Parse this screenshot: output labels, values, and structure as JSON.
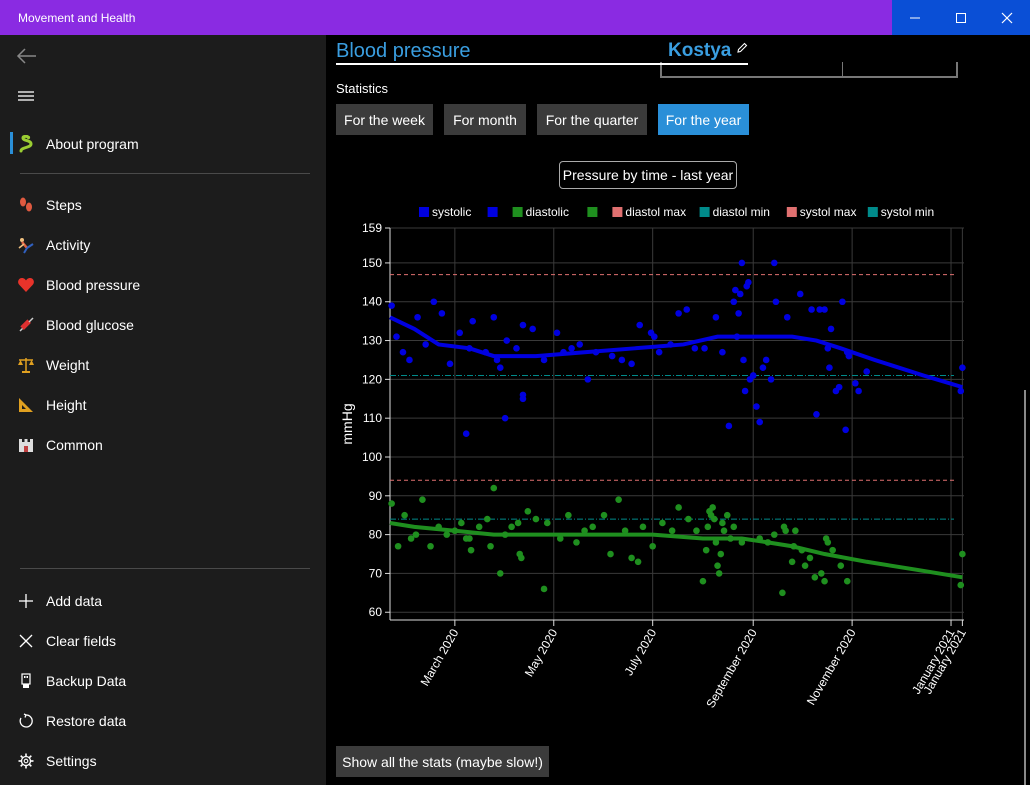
{
  "window": {
    "title": "Movement and Health"
  },
  "sidebar": {
    "top_item": {
      "label": "About program",
      "icon": "snake-icon"
    },
    "items": [
      {
        "label": "Steps",
        "icon": "footprints-icon"
      },
      {
        "label": "Activity",
        "icon": "gymnast-icon"
      },
      {
        "label": "Blood pressure",
        "icon": "heart-icon"
      },
      {
        "label": "Blood glucose",
        "icon": "syringe-icon"
      },
      {
        "label": "Weight",
        "icon": "scales-icon"
      },
      {
        "label": "Height",
        "icon": "triangle-ruler-icon"
      },
      {
        "label": "Common",
        "icon": "castle-icon"
      }
    ],
    "bottom_items": [
      {
        "label": "Add data",
        "icon": "plus-icon"
      },
      {
        "label": "Clear fields",
        "icon": "close-icon"
      },
      {
        "label": "Backup Data",
        "icon": "usb-drive-icon"
      },
      {
        "label": "Restore data",
        "icon": "refresh-icon"
      },
      {
        "label": "Settings",
        "icon": "gear-icon"
      }
    ]
  },
  "main": {
    "title": "Blood pressure",
    "user": "Kostya",
    "statistics_label": "Statistics",
    "tabs": [
      "For the week",
      "For month",
      "For the quarter",
      "For the year"
    ],
    "active_tab": "For the year",
    "chart_caption": "Pressure by time - last year",
    "show_all_label": "Show all the stats (maybe slow!)"
  },
  "colors": {
    "systolic": "#0000e0",
    "diastolic": "#1f8f1f",
    "diastol_max": "#e07070",
    "diastol_min": "#008b8b",
    "systol_max": "#e07070",
    "systol_min": "#008b8b",
    "accent": "#2a8fd8",
    "titlebar": "#8a2be2"
  },
  "chart_data": {
    "type": "scatter",
    "ylabel": "mmHg",
    "ylim": [
      58,
      159
    ],
    "y_ticks": [
      159,
      150,
      140,
      130,
      120,
      110,
      100,
      90,
      80,
      70,
      60
    ],
    "x_range": [
      "2020-01-21",
      "2021-01-09"
    ],
    "x_ticks": [
      {
        "date": "2020-03-01",
        "label": "March 2020"
      },
      {
        "date": "2020-05-01",
        "label": "May 2020"
      },
      {
        "date": "2020-07-01",
        "label": "July 2020"
      },
      {
        "date": "2020-09-01",
        "label": "September 2020"
      },
      {
        "date": "2020-11-01",
        "label": "November 2020"
      },
      {
        "date": "2021-01-01",
        "label": "January 2021"
      },
      {
        "date": "2021-01-08",
        "label": "January 2021"
      }
    ],
    "legend": [
      {
        "name": "systolic",
        "color": "#0000e0",
        "kind": "points"
      },
      {
        "name": "",
        "color": "#0000e0",
        "kind": "line"
      },
      {
        "name": "diastolic",
        "color": "#1f8f1f",
        "kind": "points"
      },
      {
        "name": "",
        "color": "#1f8f1f",
        "kind": "line"
      },
      {
        "name": "diastol max",
        "color": "#e07070",
        "kind": "dashed"
      },
      {
        "name": "diastol min",
        "color": "#008b8b",
        "kind": "dashdot"
      },
      {
        "name": "systol max",
        "color": "#e07070",
        "kind": "dashed"
      },
      {
        "name": "systol min",
        "color": "#008b8b",
        "kind": "dashdot"
      }
    ],
    "reference_lines": [
      {
        "name": "systol max",
        "value": 147,
        "color": "#e07070",
        "style": "dashed"
      },
      {
        "name": "systol min",
        "value": 121,
        "color": "#008b8b",
        "style": "dashdot"
      },
      {
        "name": "diastol max",
        "value": 94,
        "color": "#e07070",
        "style": "dashed"
      },
      {
        "name": "diastol min",
        "value": 84,
        "color": "#008b8b",
        "style": "dashdot"
      }
    ],
    "series": [
      {
        "name": "systolic",
        "color": "#0000e0",
        "points": [
          [
            "2020-01-22",
            139
          ],
          [
            "2020-01-25",
            131
          ],
          [
            "2020-01-29",
            127
          ],
          [
            "2020-02-02",
            125
          ],
          [
            "2020-02-07",
            136
          ],
          [
            "2020-02-12",
            129
          ],
          [
            "2020-02-17",
            140
          ],
          [
            "2020-02-22",
            137
          ],
          [
            "2020-02-27",
            124
          ],
          [
            "2020-03-04",
            132
          ],
          [
            "2020-03-08",
            106
          ],
          [
            "2020-03-10",
            128
          ],
          [
            "2020-03-12",
            135
          ],
          [
            "2020-03-20",
            127
          ],
          [
            "2020-03-25",
            136
          ],
          [
            "2020-03-27",
            125
          ],
          [
            "2020-03-29",
            123
          ],
          [
            "2020-04-02",
            130
          ],
          [
            "2020-04-01",
            110
          ],
          [
            "2020-04-08",
            128
          ],
          [
            "2020-04-12",
            134
          ],
          [
            "2020-04-12",
            116
          ],
          [
            "2020-04-12",
            115
          ],
          [
            "2020-04-18",
            133
          ],
          [
            "2020-04-25",
            125
          ],
          [
            "2020-05-03",
            132
          ],
          [
            "2020-05-07",
            127
          ],
          [
            "2020-05-12",
            128
          ],
          [
            "2020-05-17",
            129
          ],
          [
            "2020-05-22",
            120
          ],
          [
            "2020-05-27",
            127
          ],
          [
            "2020-06-06",
            126
          ],
          [
            "2020-06-12",
            125
          ],
          [
            "2020-06-18",
            124
          ],
          [
            "2020-06-23",
            134
          ],
          [
            "2020-06-30",
            132
          ],
          [
            "2020-07-02",
            131
          ],
          [
            "2020-07-05",
            127
          ],
          [
            "2020-07-12",
            129
          ],
          [
            "2020-07-17",
            137
          ],
          [
            "2020-07-22",
            138
          ],
          [
            "2020-07-27",
            128
          ],
          [
            "2020-08-02",
            128
          ],
          [
            "2020-08-09",
            136
          ],
          [
            "2020-08-13",
            127
          ],
          [
            "2020-08-17",
            108
          ],
          [
            "2020-08-20",
            140
          ],
          [
            "2020-08-21",
            143
          ],
          [
            "2020-08-22",
            131
          ],
          [
            "2020-08-23",
            137
          ],
          [
            "2020-08-24",
            142
          ],
          [
            "2020-08-25",
            150
          ],
          [
            "2020-08-26",
            125
          ],
          [
            "2020-08-27",
            117
          ],
          [
            "2020-08-28",
            144
          ],
          [
            "2020-08-29",
            145
          ],
          [
            "2020-08-30",
            120
          ],
          [
            "2020-09-01",
            121
          ],
          [
            "2020-09-03",
            113
          ],
          [
            "2020-09-05",
            109
          ],
          [
            "2020-09-07",
            123
          ],
          [
            "2020-09-09",
            125
          ],
          [
            "2020-09-12",
            120
          ],
          [
            "2020-09-14",
            150
          ],
          [
            "2020-09-15",
            140
          ],
          [
            "2020-09-22",
            136
          ],
          [
            "2020-09-30",
            142
          ],
          [
            "2020-10-07",
            138
          ],
          [
            "2020-10-10",
            111
          ],
          [
            "2020-10-12",
            138
          ],
          [
            "2020-10-15",
            138
          ],
          [
            "2020-10-17",
            128
          ],
          [
            "2020-10-18",
            123
          ],
          [
            "2020-10-19",
            133
          ],
          [
            "2020-10-22",
            117
          ],
          [
            "2020-10-24",
            118
          ],
          [
            "2020-10-26",
            140
          ],
          [
            "2020-10-28",
            107
          ],
          [
            "2020-10-29",
            127
          ],
          [
            "2020-10-30",
            126
          ],
          [
            "2020-11-03",
            119
          ],
          [
            "2020-11-05",
            117
          ],
          [
            "2020-11-10",
            122
          ],
          [
            "2021-01-07",
            117
          ],
          [
            "2021-01-08",
            123
          ]
        ],
        "trend": [
          [
            "2020-01-21",
            136
          ],
          [
            "2020-02-05",
            133
          ],
          [
            "2020-02-20",
            129
          ],
          [
            "2020-03-10",
            128
          ],
          [
            "2020-03-25",
            126
          ],
          [
            "2020-04-20",
            126
          ],
          [
            "2020-05-20",
            127
          ],
          [
            "2020-06-20",
            128
          ],
          [
            "2020-07-20",
            129
          ],
          [
            "2020-08-10",
            131
          ],
          [
            "2020-09-10",
            131
          ],
          [
            "2020-09-25",
            131
          ],
          [
            "2020-10-10",
            130
          ],
          [
            "2020-10-25",
            128
          ],
          [
            "2020-11-15",
            125
          ],
          [
            "2020-12-15",
            121
          ],
          [
            "2021-01-08",
            118
          ]
        ]
      },
      {
        "name": "diastolic",
        "color": "#1f8f1f",
        "points": [
          [
            "2020-01-22",
            88
          ],
          [
            "2020-01-26",
            77
          ],
          [
            "2020-01-30",
            85
          ],
          [
            "2020-02-03",
            79
          ],
          [
            "2020-02-06",
            80
          ],
          [
            "2020-02-10",
            89
          ],
          [
            "2020-02-15",
            77
          ],
          [
            "2020-02-20",
            82
          ],
          [
            "2020-02-25",
            80
          ],
          [
            "2020-03-01",
            81
          ],
          [
            "2020-03-05",
            83
          ],
          [
            "2020-03-08",
            79
          ],
          [
            "2020-03-10",
            79
          ],
          [
            "2020-03-11",
            76
          ],
          [
            "2020-03-16",
            82
          ],
          [
            "2020-03-21",
            84
          ],
          [
            "2020-03-23",
            77
          ],
          [
            "2020-03-25",
            92
          ],
          [
            "2020-03-29",
            70
          ],
          [
            "2020-04-01",
            80
          ],
          [
            "2020-04-05",
            82
          ],
          [
            "2020-04-09",
            83
          ],
          [
            "2020-04-10",
            75
          ],
          [
            "2020-04-11",
            74
          ],
          [
            "2020-04-15",
            86
          ],
          [
            "2020-04-20",
            84
          ],
          [
            "2020-04-25",
            66
          ],
          [
            "2020-04-27",
            83
          ],
          [
            "2020-05-05",
            79
          ],
          [
            "2020-05-10",
            85
          ],
          [
            "2020-05-15",
            78
          ],
          [
            "2020-05-20",
            81
          ],
          [
            "2020-05-25",
            82
          ],
          [
            "2020-06-01",
            85
          ],
          [
            "2020-06-05",
            75
          ],
          [
            "2020-06-10",
            89
          ],
          [
            "2020-06-14",
            81
          ],
          [
            "2020-06-18",
            74
          ],
          [
            "2020-06-22",
            73
          ],
          [
            "2020-06-25",
            82
          ],
          [
            "2020-07-01",
            77
          ],
          [
            "2020-07-07",
            83
          ],
          [
            "2020-07-13",
            81
          ],
          [
            "2020-07-17",
            87
          ],
          [
            "2020-07-23",
            84
          ],
          [
            "2020-07-28",
            81
          ],
          [
            "2020-08-01",
            68
          ],
          [
            "2020-08-03",
            76
          ],
          [
            "2020-08-04",
            82
          ],
          [
            "2020-08-05",
            86
          ],
          [
            "2020-08-06",
            85
          ],
          [
            "2020-08-07",
            87
          ],
          [
            "2020-08-08",
            84
          ],
          [
            "2020-08-09",
            78
          ],
          [
            "2020-08-10",
            72
          ],
          [
            "2020-08-11",
            70
          ],
          [
            "2020-08-12",
            75
          ],
          [
            "2020-08-13",
            83
          ],
          [
            "2020-08-14",
            81
          ],
          [
            "2020-08-16",
            85
          ],
          [
            "2020-08-18",
            79
          ],
          [
            "2020-08-20",
            82
          ],
          [
            "2020-08-25",
            78
          ],
          [
            "2020-09-05",
            79
          ],
          [
            "2020-09-10",
            78
          ],
          [
            "2020-09-14",
            80
          ],
          [
            "2020-09-19",
            65
          ],
          [
            "2020-09-20",
            82
          ],
          [
            "2020-09-21",
            81
          ],
          [
            "2020-09-25",
            73
          ],
          [
            "2020-09-26",
            77
          ],
          [
            "2020-09-27",
            81
          ],
          [
            "2020-10-01",
            76
          ],
          [
            "2020-10-03",
            72
          ],
          [
            "2020-10-06",
            74
          ],
          [
            "2020-10-09",
            69
          ],
          [
            "2020-10-13",
            70
          ],
          [
            "2020-10-15",
            68
          ],
          [
            "2020-10-16",
            79
          ],
          [
            "2020-10-17",
            78
          ],
          [
            "2020-10-20",
            76
          ],
          [
            "2020-10-25",
            72
          ],
          [
            "2020-10-29",
            68
          ],
          [
            "2021-01-07",
            67
          ],
          [
            "2021-01-08",
            75
          ]
        ],
        "trend": [
          [
            "2020-01-21",
            83
          ],
          [
            "2020-02-05",
            82
          ],
          [
            "2020-03-01",
            81
          ],
          [
            "2020-03-25",
            80
          ],
          [
            "2020-04-25",
            80
          ],
          [
            "2020-06-01",
            80
          ],
          [
            "2020-07-01",
            80
          ],
          [
            "2020-08-01",
            79
          ],
          [
            "2020-08-25",
            79
          ],
          [
            "2020-09-10",
            78
          ],
          [
            "2020-09-25",
            77
          ],
          [
            "2020-10-15",
            75
          ],
          [
            "2020-11-10",
            73
          ],
          [
            "2020-12-10",
            71
          ],
          [
            "2021-01-08",
            69
          ]
        ]
      }
    ]
  }
}
